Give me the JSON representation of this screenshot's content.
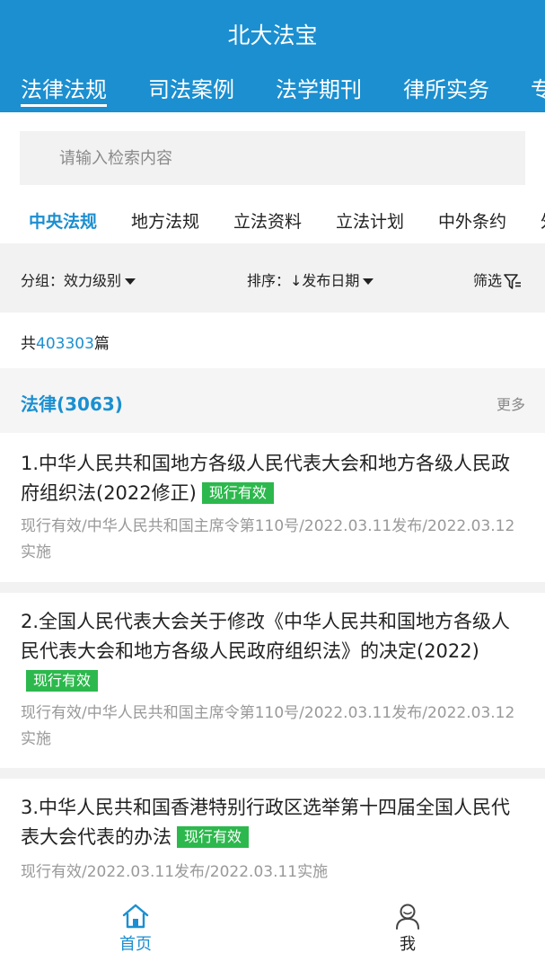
{
  "app": {
    "title": "北大法宝"
  },
  "top_tabs": [
    {
      "label": "法律法规",
      "active": true
    },
    {
      "label": "司法案例",
      "active": false
    },
    {
      "label": "法学期刊",
      "active": false
    },
    {
      "label": "律所实务",
      "active": false
    },
    {
      "label": "专",
      "active": false
    }
  ],
  "search": {
    "placeholder": "请输入检索内容",
    "value": ""
  },
  "category_tabs": [
    {
      "label": "中央法规",
      "active": true
    },
    {
      "label": "地方法规",
      "active": false
    },
    {
      "label": "立法资料",
      "active": false
    },
    {
      "label": "立法计划",
      "active": false
    },
    {
      "label": "中外条约",
      "active": false
    },
    {
      "label": "外",
      "active": false
    }
  ],
  "filters": {
    "group_label": "分组：效力级别",
    "sort_label": "排序：↓发布日期",
    "filter_label": "筛选"
  },
  "results": {
    "prefix": "共",
    "count": "403303",
    "suffix": "篇"
  },
  "section": {
    "title": "法律(3063)",
    "more": "更多"
  },
  "items": [
    {
      "title": "1.中华人民共和国地方各级人民代表大会和地方各级人民政府组织法(2022修正)",
      "badge": "现行有效",
      "meta": "现行有效/中华人民共和国主席令第110号/2022.03.11发布/2022.03.12实施"
    },
    {
      "title": "2.全国人民代表大会关于修改《中华人民共和国地方各级人民代表大会和地方各级人民政府组织法》的决定(2022)",
      "badge": "现行有效",
      "meta": "现行有效/中华人民共和国主席令第110号/2022.03.11发布/2022.03.12实施"
    },
    {
      "title": "3.中华人民共和国香港特别行政区选举第十四届全国人民代表大会代表的办法",
      "badge": "现行有效",
      "meta": "现行有效/2022.03.11发布/2022.03.11实施"
    }
  ],
  "bottom_nav": [
    {
      "label": "首页",
      "icon": "home-icon",
      "active": true
    },
    {
      "label": "我",
      "icon": "user-icon",
      "active": false
    }
  ],
  "colors": {
    "brand": "#1b8fd0",
    "badge": "#2db84d",
    "meta": "#999999"
  }
}
